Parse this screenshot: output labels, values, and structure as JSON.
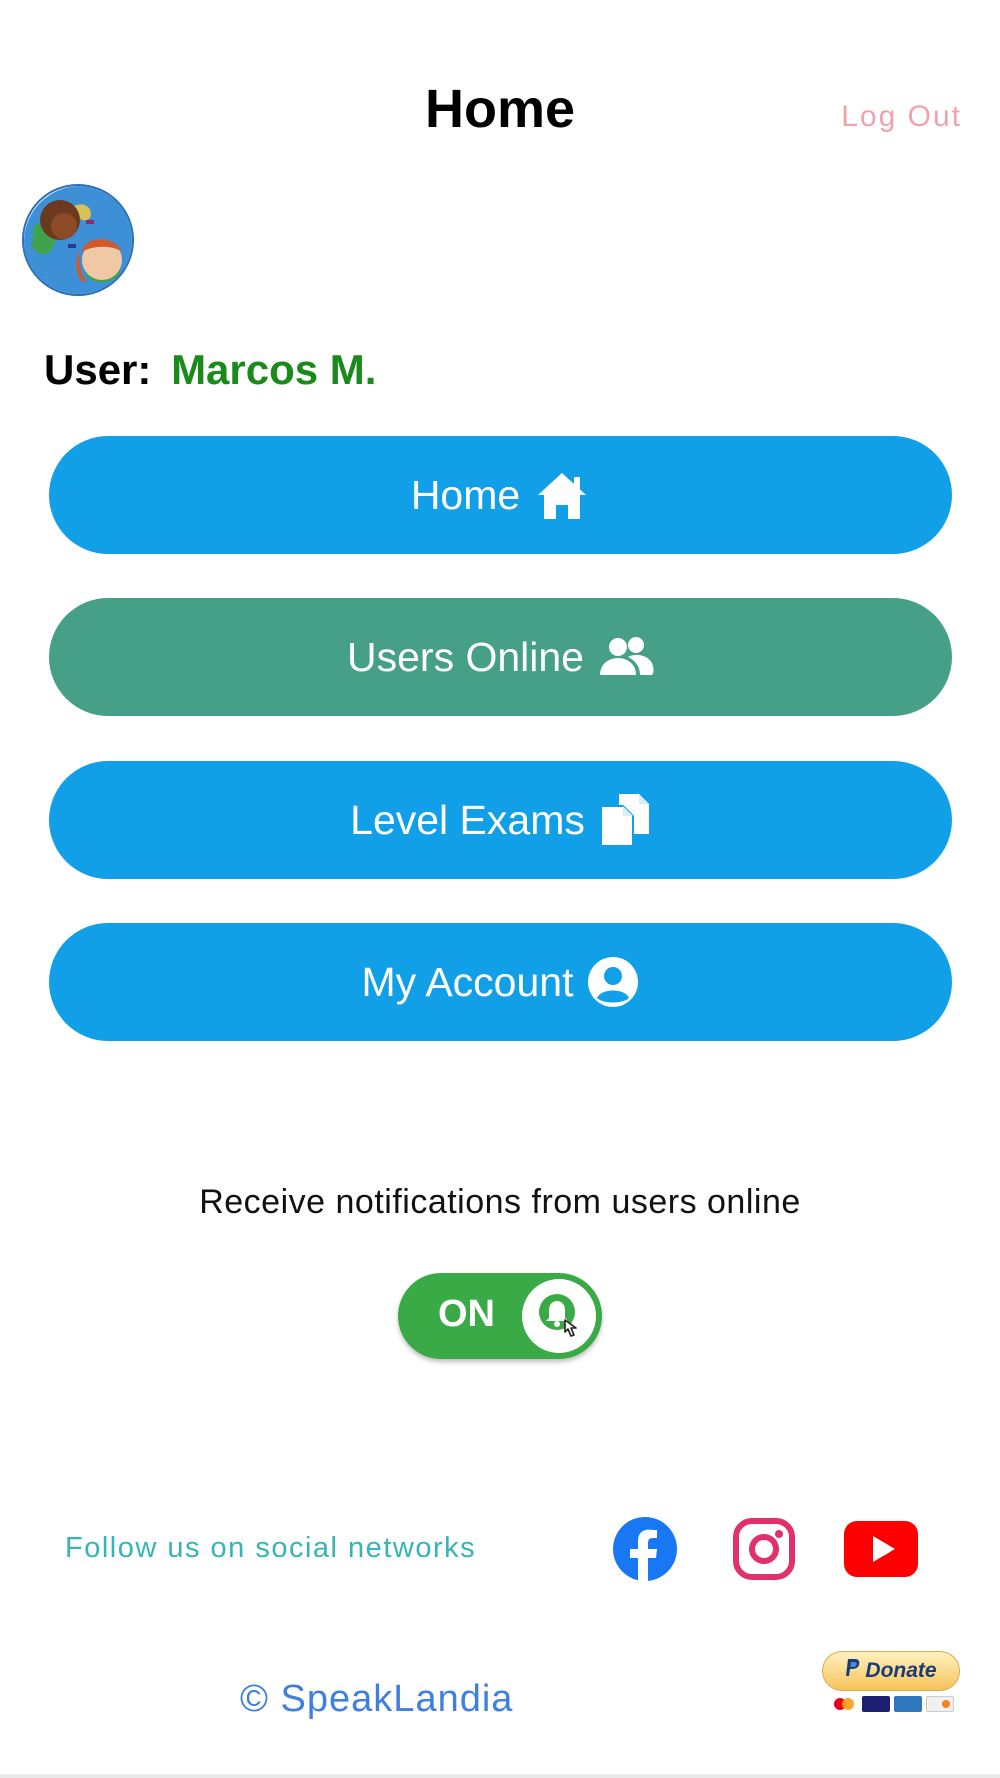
{
  "header": {
    "title": "Home",
    "logout_label": "Log Out"
  },
  "user": {
    "prefix": "User:",
    "name": "Marcos M."
  },
  "menu": [
    {
      "label": "Home",
      "icon": "house-icon",
      "color": "#11a0e8"
    },
    {
      "label": "Users Online",
      "icon": "users-icon",
      "color": "#46a087"
    },
    {
      "label": "Level Exams",
      "icon": "documents-icon",
      "color": "#11a0e8"
    },
    {
      "label": "My Account",
      "icon": "user-circle-icon",
      "color": "#11a0e8"
    }
  ],
  "notifications": {
    "label": "Receive notifications from users online",
    "toggle_text": "ON",
    "enabled": true
  },
  "footer": {
    "follow_text": "Follow us on social networks",
    "social": [
      "facebook-icon",
      "instagram-icon",
      "youtube-icon"
    ],
    "copyright": "© SpeakLandia",
    "donate_label": "Donate"
  },
  "colors": {
    "primary_blue": "#11a0e8",
    "users_green": "#46a087",
    "toggle_green": "#3aaa47",
    "username_green": "#1a8a1a",
    "logout_pink": "#f0a3aa",
    "follow_teal": "#37b4b4",
    "copyright_blue": "#3f7fe0"
  }
}
